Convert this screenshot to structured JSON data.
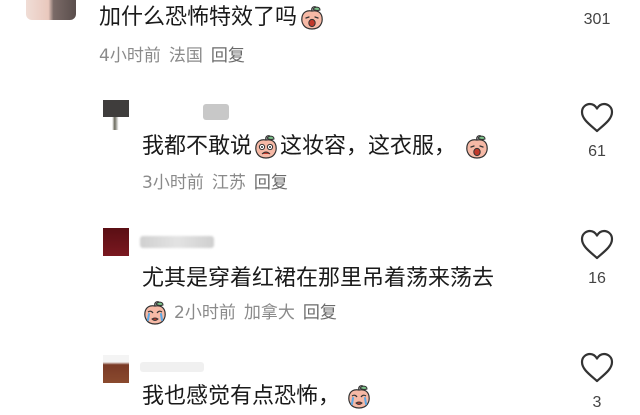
{
  "comments": [
    {
      "text_parts": [
        "加什么恐怖特效了吗"
      ],
      "time": "4小时前",
      "location": "法国",
      "reply_label": "回复",
      "likes": "301",
      "emojis": [
        "peach-wronged-emoji"
      ]
    },
    {
      "text_parts": [
        "我都不敢说",
        "这妆容，这衣服，"
      ],
      "time": "3小时前",
      "location": "江苏",
      "reply_label": "回复",
      "likes": "61",
      "emojis": [
        "peach-scared-emoji",
        "peach-wronged-emoji"
      ]
    },
    {
      "text_parts": [
        "尤其是穿着红裙在那里吊着荡来荡去"
      ],
      "time": "2小时前",
      "location": "加拿大",
      "reply_label": "回复",
      "likes": "16",
      "emojis": [
        "peach-crying-emoji"
      ]
    },
    {
      "text_parts": [
        "我也感觉有点恐怖，"
      ],
      "likes": "3",
      "emojis": [
        "peach-crying-emoji"
      ]
    }
  ],
  "colors": {
    "text": "#1a1a1a",
    "meta": "#8a8a8a",
    "heart_stroke": "#333333",
    "emoji_peach": "#f6b9a6"
  },
  "icons": [
    "heart-outline-icon"
  ]
}
